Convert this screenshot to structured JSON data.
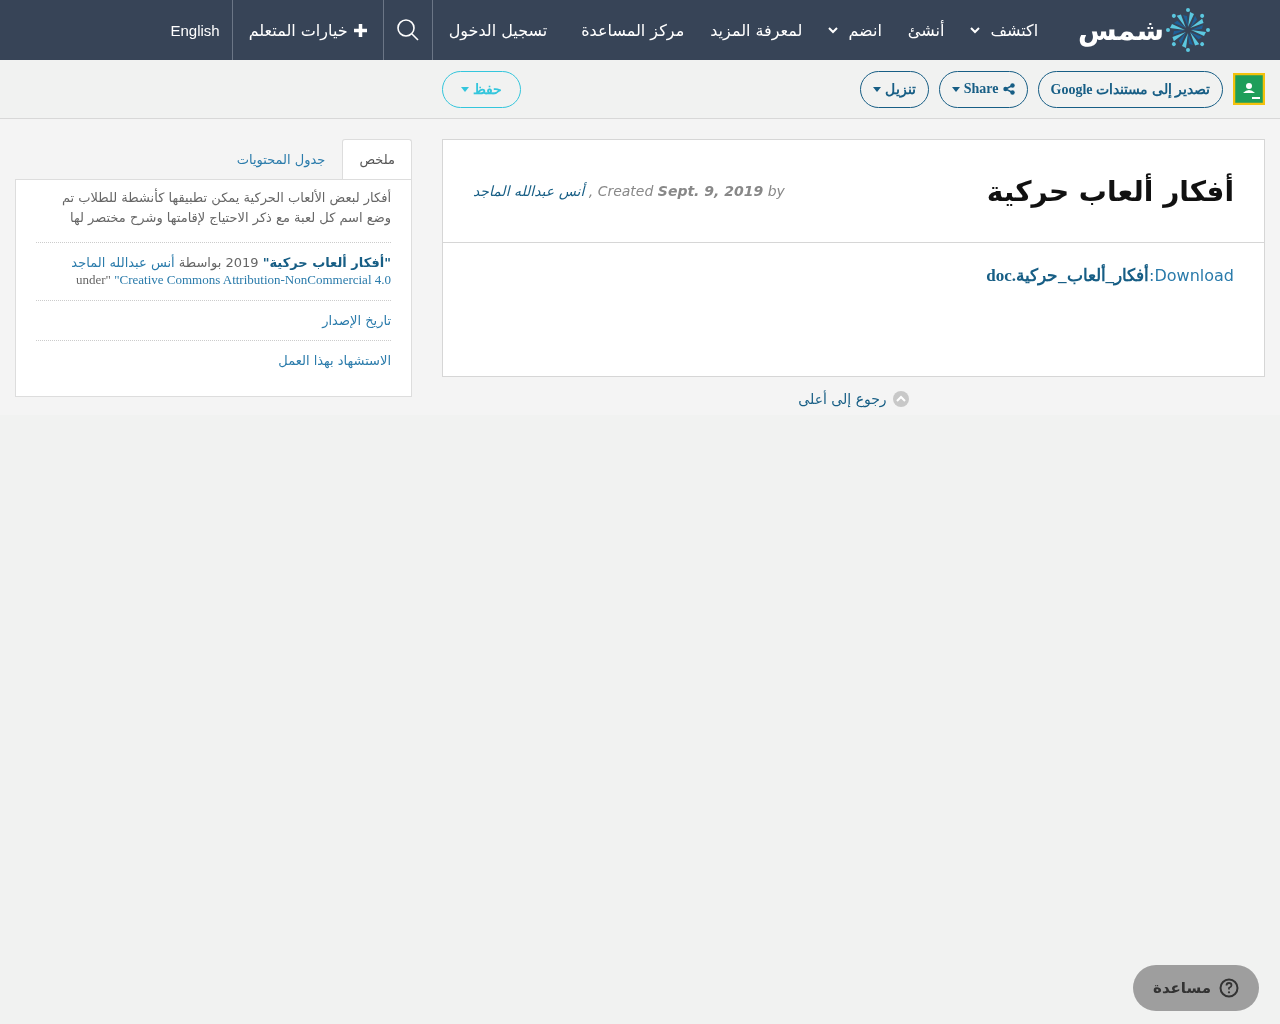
{
  "header": {
    "logo": "شمس",
    "nav": [
      {
        "label": "اكتشف",
        "dropdown": true
      },
      {
        "label": "أنشئ",
        "dropdown": false
      },
      {
        "label": "انضم",
        "dropdown": true
      },
      {
        "label": "لمعرفة المزيد",
        "dropdown": false
      },
      {
        "label": "مركز المساعدة",
        "dropdown": false
      }
    ],
    "login": "تسجيل الدخول",
    "learner_options": "خيارات المتعلم",
    "language": "English"
  },
  "toolbar": {
    "export": "تصدير إلى مستندات Google",
    "share": "Share",
    "download": "تنزيل",
    "save": "حفظ"
  },
  "resource": {
    "title": "أفكار ألعاب حركية",
    "author": "أنس عبدالله الماجد",
    "meta": ", Created **Sept. 9, 2019** by",
    "download_label": "Download:",
    "file": "أفكار_ألعاب_حركية.doc"
  },
  "back_to_top": "رجوع إلى أعلى",
  "sidebar": {
    "tabs": [
      {
        "label": "ملخص",
        "selected": true
      },
      {
        "label": "جدول المحتويات",
        "selected": false
      }
    ],
    "summary": "أفكار لبعض الألعاب الحركية يمكن تطبيقها كأنشطة للطلاب تم وضع اسم كل لعبة مع ذكر الاحتياج لإقامتها وشرح مختصر لها",
    "attribution": {
      "title": "\"أفكار ألعاب حركية\"",
      "by": "2019 بواسطة",
      "author": "أنس عبدالله الماجد",
      "license": "\"Creative Commons Attribution-NonCommercial 4.0",
      "under": "under\""
    },
    "links": [
      "تاريخ الإصدار",
      "الاستشهاد بهذا العمل"
    ]
  },
  "help_button": "مساعدة"
}
